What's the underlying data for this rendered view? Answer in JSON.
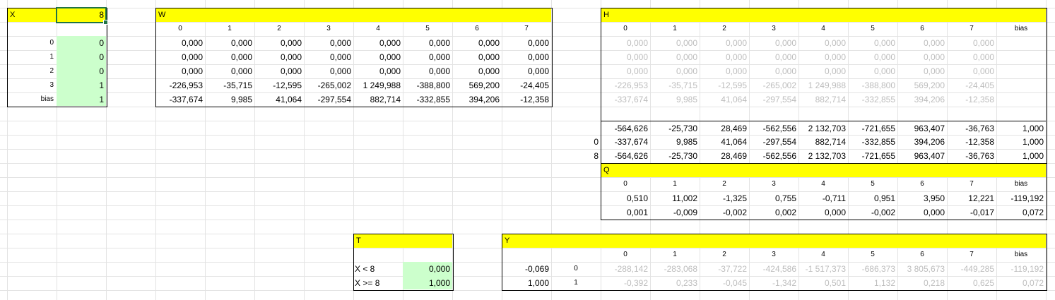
{
  "x_block": {
    "title": "X",
    "value": "8",
    "rows": [
      {
        "label": "0",
        "value": "0"
      },
      {
        "label": "1",
        "value": "0"
      },
      {
        "label": "2",
        "value": "0"
      },
      {
        "label": "3",
        "value": "1"
      },
      {
        "label": "bias",
        "value": "1"
      }
    ]
  },
  "w_block": {
    "title": "W",
    "headers": [
      "0",
      "1",
      "2",
      "3",
      "4",
      "5",
      "6",
      "7"
    ],
    "rows": [
      [
        "0,000",
        "0,000",
        "0,000",
        "0,000",
        "0,000",
        "0,000",
        "0,000",
        "0,000"
      ],
      [
        "0,000",
        "0,000",
        "0,000",
        "0,000",
        "0,000",
        "0,000",
        "0,000",
        "0,000"
      ],
      [
        "0,000",
        "0,000",
        "0,000",
        "0,000",
        "0,000",
        "0,000",
        "0,000",
        "0,000"
      ],
      [
        "-226,953",
        "-35,715",
        "-12,595",
        "-265,002",
        "1 249,988",
        "-388,800",
        "569,200",
        "-24,405"
      ],
      [
        "-337,674",
        "9,985",
        "41,064",
        "-297,554",
        "882,714",
        "-332,855",
        "394,206",
        "-12,358"
      ]
    ]
  },
  "h_block": {
    "title": "H",
    "headers": [
      "0",
      "1",
      "2",
      "3",
      "4",
      "5",
      "6",
      "7",
      "bias"
    ],
    "grey_rows": [
      [
        "0,000",
        "0,000",
        "0,000",
        "0,000",
        "0,000",
        "0,000",
        "0,000",
        "0,000"
      ],
      [
        "0,000",
        "0,000",
        "0,000",
        "0,000",
        "0,000",
        "0,000",
        "0,000",
        "0,000"
      ],
      [
        "0,000",
        "0,000",
        "0,000",
        "0,000",
        "0,000",
        "0,000",
        "0,000",
        "0,000"
      ],
      [
        "-226,953",
        "-35,715",
        "-12,595",
        "-265,002",
        "1 249,988",
        "-388,800",
        "569,200",
        "-24,405"
      ],
      [
        "-337,674",
        "9,985",
        "41,064",
        "-297,554",
        "882,714",
        "-332,855",
        "394,206",
        "-12,358"
      ]
    ],
    "sum_rows": [
      {
        "label": "",
        "values": [
          "-564,626",
          "-25,730",
          "28,469",
          "-562,556",
          "2 132,703",
          "-721,655",
          "963,407",
          "-36,763",
          "1,000"
        ]
      },
      {
        "label": "0",
        "values": [
          "-337,674",
          "9,985",
          "41,064",
          "-297,554",
          "882,714",
          "-332,855",
          "394,206",
          "-12,358",
          "1,000"
        ]
      },
      {
        "label": "8",
        "values": [
          "-564,626",
          "-25,730",
          "28,469",
          "-562,556",
          "2 132,703",
          "-721,655",
          "963,407",
          "-36,763",
          "1,000"
        ]
      }
    ]
  },
  "q_block": {
    "title": "Q",
    "headers": [
      "0",
      "1",
      "2",
      "3",
      "4",
      "5",
      "6",
      "7",
      "bias"
    ],
    "rows": [
      [
        "0,510",
        "11,002",
        "-1,325",
        "0,755",
        "-0,711",
        "0,951",
        "3,950",
        "12,221",
        "-119,192"
      ],
      [
        "0,001",
        "-0,009",
        "-0,002",
        "0,002",
        "0,000",
        "-0,002",
        "0,000",
        "-0,017",
        "0,072"
      ]
    ]
  },
  "t_block": {
    "title": "T",
    "rows": [
      {
        "label": "X < 8",
        "value": "0,000"
      },
      {
        "label": "X >= 8",
        "value": "1,000"
      }
    ]
  },
  "y_block": {
    "title": "Y",
    "headers": [
      "0",
      "1",
      "2",
      "3",
      "4",
      "5",
      "6",
      "7",
      "bias"
    ],
    "side_values": [
      "-0,069",
      "1,000"
    ],
    "row_labels": [
      "0",
      "1"
    ],
    "rows": [
      [
        "-288,142",
        "-283,068",
        "-37,722",
        "-424,586",
        "-1 517,373",
        "-686,373",
        "3 805,673",
        "-449,285",
        "-119,192"
      ],
      [
        "-0,392",
        "0,233",
        "-0,045",
        "-1,342",
        "0,501",
        "1,132",
        "0,218",
        "0,625",
        "0,072"
      ]
    ]
  }
}
